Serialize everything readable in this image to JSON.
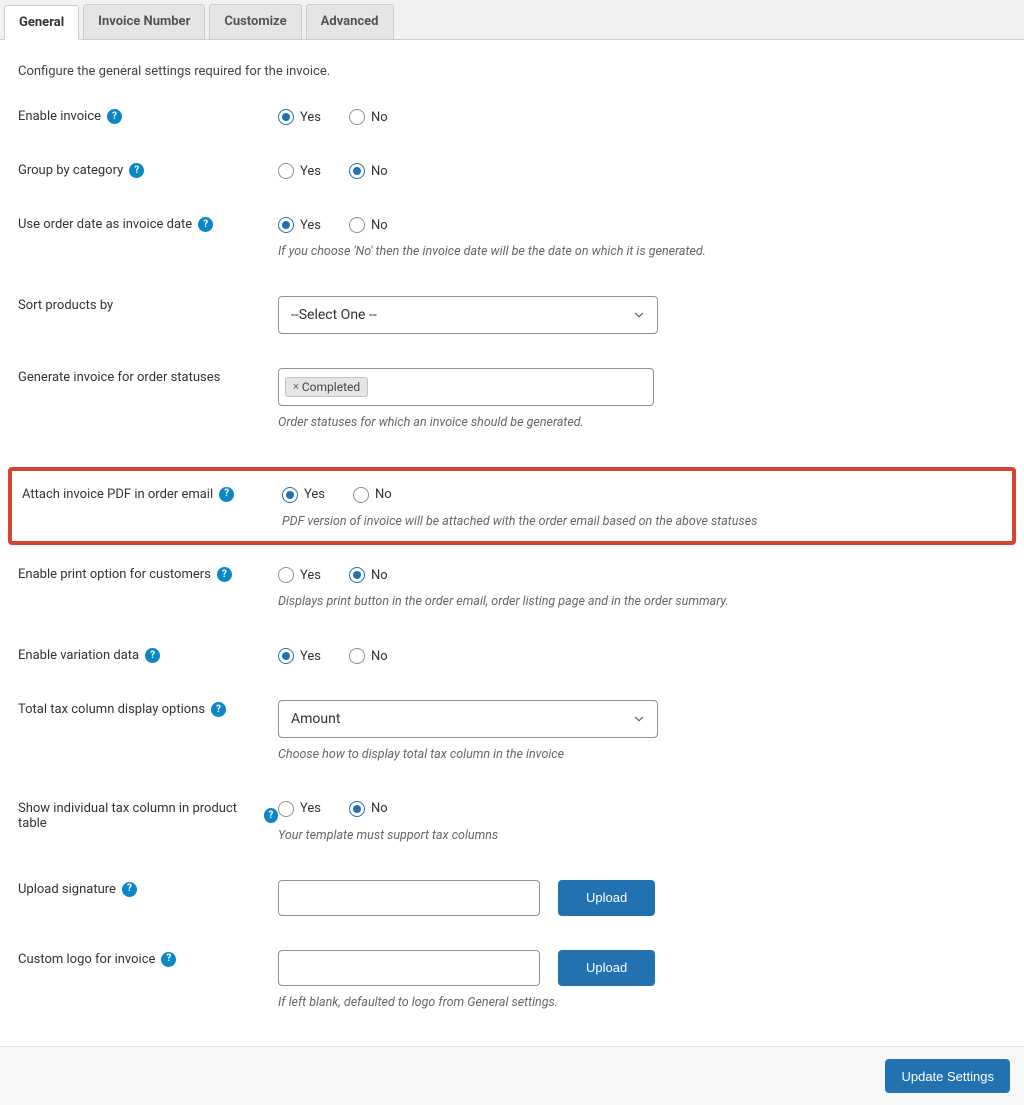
{
  "tabs": {
    "general": "General",
    "invoice_number": "Invoice Number",
    "customize": "Customize",
    "advanced": "Advanced"
  },
  "intro": "Configure the general settings required for the invoice.",
  "labels": {
    "yes": "Yes",
    "no": "No",
    "upload": "Upload",
    "update_settings": "Update Settings"
  },
  "rows": {
    "enable_invoice": {
      "label": "Enable invoice",
      "value": "yes"
    },
    "group_category": {
      "label": "Group by category",
      "value": "no"
    },
    "use_order_date": {
      "label": "Use order date as invoice date",
      "value": "yes",
      "desc": "If you choose 'No' then the invoice date will be the date on which it is generated."
    },
    "sort_products": {
      "label": "Sort products by",
      "selected": "--Select One --"
    },
    "generate_statuses": {
      "label": "Generate invoice for order statuses",
      "tag": "Completed",
      "desc": "Order statuses for which an invoice should be generated."
    },
    "attach_pdf": {
      "label": "Attach invoice PDF in order email",
      "value": "yes",
      "desc": "PDF version of invoice will be attached with the order email based on the above statuses"
    },
    "enable_print": {
      "label": "Enable print option for customers",
      "value": "no",
      "desc": "Displays print button in the order email, order listing page and in the order summary."
    },
    "enable_variation": {
      "label": "Enable variation data",
      "value": "yes"
    },
    "total_tax": {
      "label": "Total tax column display options",
      "selected": "Amount",
      "desc": "Choose how to display total tax column in the invoice"
    },
    "individual_tax": {
      "label": "Show individual tax column in product table",
      "value": "no",
      "desc": "Your template must support tax columns"
    },
    "upload_signature": {
      "label": "Upload signature"
    },
    "custom_logo": {
      "label": "Custom logo for invoice",
      "desc": "If left blank, defaulted to logo from General settings."
    }
  }
}
